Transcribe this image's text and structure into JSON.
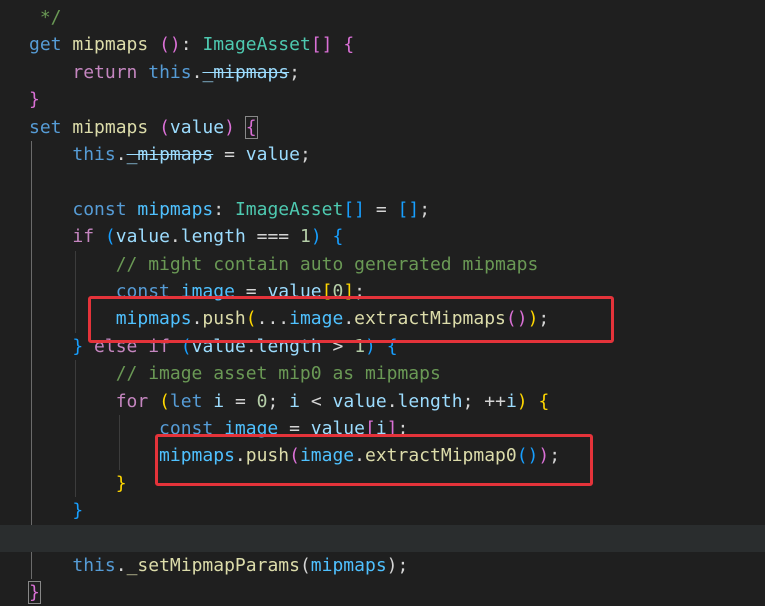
{
  "colors": {
    "background": "#1f1f1f",
    "keyword_blue": "#569cd6",
    "keyword_purple": "#c586c0",
    "variable": "#9cdcfe",
    "function": "#dcdcaa",
    "type": "#4ec9b0",
    "number": "#b5cea8",
    "comment": "#6a9955",
    "punct": "#d4d4d4",
    "bracket_gold": "#ffd700",
    "bracket_pink": "#da70d6",
    "bracket_blue": "#179fff",
    "highlight_box": "#e4333a"
  },
  "lines": [
    [
      {
        "t": " */",
        "c": "#6a9955"
      }
    ],
    [
      {
        "t": "get",
        "c": "#569cd6"
      },
      {
        "t": " "
      },
      {
        "t": "mipmaps",
        "c": "#dcdcaa"
      },
      {
        "t": " "
      },
      {
        "t": "()",
        "c": "#da70d6"
      },
      {
        "t": ": "
      },
      {
        "t": "ImageAsset",
        "c": "#4ec9b0"
      },
      {
        "t": "[]",
        "c": "#da70d6"
      },
      {
        "t": " "
      },
      {
        "t": "{",
        "c": "#da70d6"
      }
    ],
    [
      {
        "t": "    "
      },
      {
        "t": "return",
        "c": "#c586c0"
      },
      {
        "t": " "
      },
      {
        "t": "this",
        "c": "#569cd6"
      },
      {
        "t": "."
      },
      {
        "t": "_mipmaps",
        "c": "#9cdcfe",
        "s": true
      },
      {
        "t": ";"
      }
    ],
    [
      {
        "t": "}",
        "c": "#da70d6"
      }
    ],
    [
      {
        "t": "set",
        "c": "#569cd6"
      },
      {
        "t": " "
      },
      {
        "t": "mipmaps",
        "c": "#dcdcaa"
      },
      {
        "t": " "
      },
      {
        "t": "(",
        "c": "#da70d6"
      },
      {
        "t": "value",
        "c": "#9cdcfe"
      },
      {
        "t": ")",
        "c": "#da70d6"
      },
      {
        "t": " "
      },
      {
        "t": "{",
        "c": "#da70d6",
        "m": true
      }
    ],
    [
      {
        "t": "    "
      },
      {
        "t": "this",
        "c": "#569cd6"
      },
      {
        "t": "."
      },
      {
        "t": "_mipmaps",
        "c": "#9cdcfe",
        "s": true
      },
      {
        "t": " = "
      },
      {
        "t": "value",
        "c": "#9cdcfe"
      },
      {
        "t": ";"
      }
    ],
    [],
    [
      {
        "t": "    "
      },
      {
        "t": "const",
        "c": "#569cd6"
      },
      {
        "t": " "
      },
      {
        "t": "mipmaps",
        "c": "#4fc1ff"
      },
      {
        "t": ": "
      },
      {
        "t": "ImageAsset",
        "c": "#4ec9b0"
      },
      {
        "t": "[]",
        "c": "#179fff"
      },
      {
        "t": " = "
      },
      {
        "t": "[]",
        "c": "#179fff"
      },
      {
        "t": ";"
      }
    ],
    [
      {
        "t": "    "
      },
      {
        "t": "if",
        "c": "#c586c0"
      },
      {
        "t": " "
      },
      {
        "t": "(",
        "c": "#179fff"
      },
      {
        "t": "value",
        "c": "#9cdcfe"
      },
      {
        "t": "."
      },
      {
        "t": "length",
        "c": "#9cdcfe"
      },
      {
        "t": " === "
      },
      {
        "t": "1",
        "c": "#b5cea8"
      },
      {
        "t": ")",
        "c": "#179fff"
      },
      {
        "t": " "
      },
      {
        "t": "{",
        "c": "#179fff"
      }
    ],
    [
      {
        "t": "        "
      },
      {
        "t": "// might contain auto generated mipmaps",
        "c": "#6a9955"
      }
    ],
    [
      {
        "t": "        "
      },
      {
        "t": "const",
        "c": "#569cd6"
      },
      {
        "t": " "
      },
      {
        "t": "image",
        "c": "#4fc1ff"
      },
      {
        "t": " = "
      },
      {
        "t": "value",
        "c": "#9cdcfe"
      },
      {
        "t": "[",
        "c": "#ffd700"
      },
      {
        "t": "0",
        "c": "#b5cea8"
      },
      {
        "t": "]",
        "c": "#ffd700"
      },
      {
        "t": ";"
      }
    ],
    [
      {
        "t": "        "
      },
      {
        "t": "mipmaps",
        "c": "#4fc1ff"
      },
      {
        "t": "."
      },
      {
        "t": "push",
        "c": "#dcdcaa"
      },
      {
        "t": "(",
        "c": "#ffd700"
      },
      {
        "t": "..."
      },
      {
        "t": "image",
        "c": "#4fc1ff"
      },
      {
        "t": "."
      },
      {
        "t": "extractMipmaps",
        "c": "#dcdcaa"
      },
      {
        "t": "()",
        "c": "#da70d6"
      },
      {
        "t": ")",
        "c": "#ffd700"
      },
      {
        "t": ";"
      }
    ],
    [
      {
        "t": "    "
      },
      {
        "t": "}",
        "c": "#179fff"
      },
      {
        "t": " "
      },
      {
        "t": "else",
        "c": "#c586c0"
      },
      {
        "t": " "
      },
      {
        "t": "if",
        "c": "#c586c0"
      },
      {
        "t": " "
      },
      {
        "t": "(",
        "c": "#179fff"
      },
      {
        "t": "value",
        "c": "#9cdcfe"
      },
      {
        "t": "."
      },
      {
        "t": "length",
        "c": "#9cdcfe"
      },
      {
        "t": " > "
      },
      {
        "t": "1",
        "c": "#b5cea8"
      },
      {
        "t": ")",
        "c": "#179fff"
      },
      {
        "t": " "
      },
      {
        "t": "{",
        "c": "#179fff"
      }
    ],
    [
      {
        "t": "        "
      },
      {
        "t": "// image asset mip0 as mipmaps",
        "c": "#6a9955"
      }
    ],
    [
      {
        "t": "        "
      },
      {
        "t": "for",
        "c": "#c586c0"
      },
      {
        "t": " "
      },
      {
        "t": "(",
        "c": "#ffd700"
      },
      {
        "t": "let",
        "c": "#569cd6"
      },
      {
        "t": " "
      },
      {
        "t": "i",
        "c": "#9cdcfe"
      },
      {
        "t": " = "
      },
      {
        "t": "0",
        "c": "#b5cea8"
      },
      {
        "t": "; "
      },
      {
        "t": "i",
        "c": "#9cdcfe"
      },
      {
        "t": " < "
      },
      {
        "t": "value",
        "c": "#9cdcfe"
      },
      {
        "t": "."
      },
      {
        "t": "length",
        "c": "#9cdcfe"
      },
      {
        "t": "; ++"
      },
      {
        "t": "i",
        "c": "#9cdcfe"
      },
      {
        "t": ")",
        "c": "#ffd700"
      },
      {
        "t": " "
      },
      {
        "t": "{",
        "c": "#ffd700"
      }
    ],
    [
      {
        "t": "            "
      },
      {
        "t": "const",
        "c": "#569cd6"
      },
      {
        "t": " "
      },
      {
        "t": "image",
        "c": "#4fc1ff"
      },
      {
        "t": " = "
      },
      {
        "t": "value",
        "c": "#9cdcfe"
      },
      {
        "t": "[",
        "c": "#da70d6"
      },
      {
        "t": "i",
        "c": "#9cdcfe"
      },
      {
        "t": "]",
        "c": "#da70d6"
      },
      {
        "t": ";"
      }
    ],
    [
      {
        "t": "            "
      },
      {
        "t": "mipmaps",
        "c": "#4fc1ff"
      },
      {
        "t": "."
      },
      {
        "t": "push",
        "c": "#dcdcaa"
      },
      {
        "t": "(",
        "c": "#da70d6"
      },
      {
        "t": "image",
        "c": "#4fc1ff"
      },
      {
        "t": "."
      },
      {
        "t": "extractMipmap0",
        "c": "#dcdcaa"
      },
      {
        "t": "()",
        "c": "#179fff"
      },
      {
        "t": ")",
        "c": "#da70d6"
      },
      {
        "t": ";"
      }
    ],
    [
      {
        "t": "        "
      },
      {
        "t": "}",
        "c": "#ffd700"
      }
    ],
    [
      {
        "t": "    "
      },
      {
        "t": "}",
        "c": "#179fff"
      }
    ],
    [],
    [
      {
        "t": "    "
      },
      {
        "t": "this",
        "c": "#569cd6"
      },
      {
        "t": "."
      },
      {
        "t": "_setMipmapParams",
        "c": "#dcdcaa"
      },
      {
        "t": "("
      },
      {
        "t": "mipmaps",
        "c": "#4fc1ff"
      },
      {
        "t": ")"
      },
      {
        "t": ";"
      }
    ],
    [
      {
        "t": "}",
        "c": "#da70d6",
        "m": true
      }
    ]
  ]
}
